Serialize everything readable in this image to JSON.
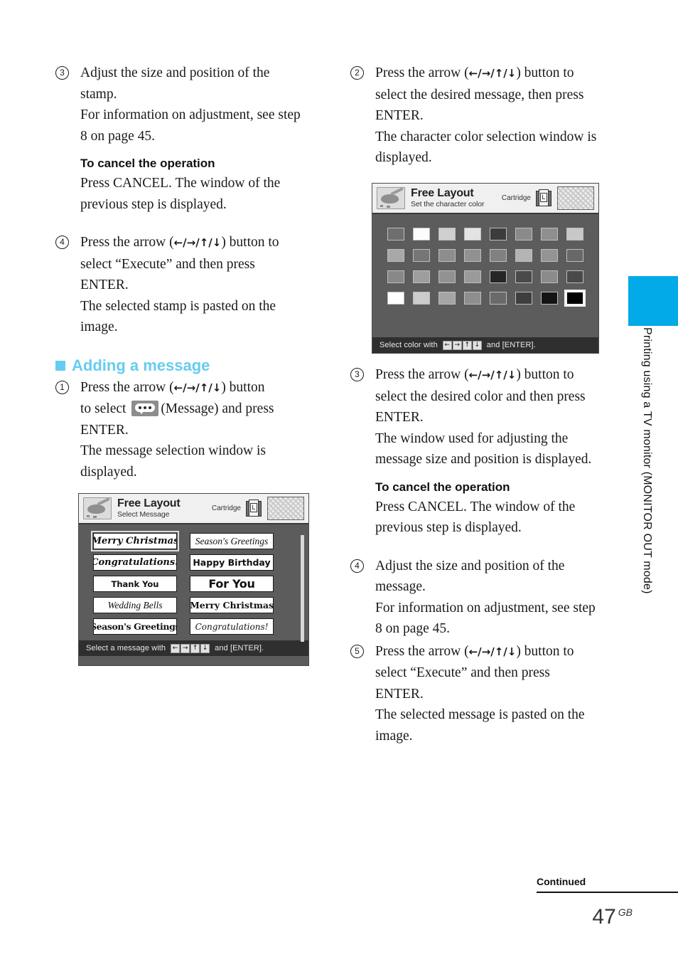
{
  "page": {
    "number": "47",
    "region_code": "GB",
    "continued_label": "Continued",
    "side_tab_text": "Printing using a TV monitor  (MONITOR OUT mode)",
    "accent_color": "#03AAE8",
    "heading_color": "#66CCF0"
  },
  "left_column": {
    "step3": {
      "num": "3",
      "line1": "Adjust the size and position of the stamp.",
      "line2": "For information on adjustment, see step 8 on page 45."
    },
    "cancel_heading": "To cancel the operation",
    "cancel_body": "Press CANCEL.  The window of the previous step is displayed.",
    "step4": {
      "num": "4",
      "line1_a": "Press the arrow (",
      "arrows": "←/→/↑/↓",
      "line1_b": ") button to select “Execute” and then press ENTER.",
      "line2": "The selected stamp is pasted on the image."
    },
    "section_heading": "Adding a message",
    "step1": {
      "num": "1",
      "line1_a": "Press the arrow (",
      "arrows": "←/→/↑/↓",
      "line1_b": ") button",
      "line2_a": "to select",
      "line2_b": "(Message) and press ENTER.",
      "line3": "The message selection window is displayed."
    }
  },
  "right_column": {
    "step2": {
      "num": "2",
      "line1_a": "Press the arrow  (",
      "arrows": "←/→/↑/↓",
      "line1_b": ") button to select the desired message, then press ENTER.",
      "line2": "The character color selection window is displayed."
    },
    "step3": {
      "num": "3",
      "line1_a": "Press the arrow (",
      "arrows": "←/→/↑/↓",
      "line1_b": ") button to select the desired color and then press ENTER.",
      "line2": "The window used for adjusting the message size and position is displayed."
    },
    "cancel_heading": "To cancel the operation",
    "cancel_body": "Press CANCEL.  The window of the previous step is displayed.",
    "step4": {
      "num": "4",
      "line1": "Adjust the size and position of the message.",
      "line2": "For information on adjustment, see step 8 on page 45."
    },
    "step5": {
      "num": "5",
      "line1_a": "Press the arrow (",
      "arrows": "←/→/↑/↓",
      "line1_b": ") button to select “Execute” and then press ENTER.",
      "line2": "The selected message is pasted on the image."
    }
  },
  "message_window": {
    "title": "Free Layout",
    "subtitle": "Select Message",
    "cartridge_label": "Cartridge",
    "cartridge_size": "L",
    "footer_prefix": "Select a message with",
    "footer_keys": [
      "←",
      "→",
      "↑",
      "↓"
    ],
    "footer_suffix": "and [ENTER].",
    "messages": [
      {
        "text": "Merry Christmas",
        "style": "f-script",
        "selected": true
      },
      {
        "text": "Season's Greetings",
        "style": "f-serif-i",
        "selected": false
      },
      {
        "text": "Congratulations!",
        "style": "f-script",
        "selected": false
      },
      {
        "text": "Happy Birthday",
        "style": "f-sans-b",
        "selected": false
      },
      {
        "text": "Thank You",
        "style": "f-sans-s",
        "selected": false
      },
      {
        "text": "For You",
        "style": "f-sans-bb",
        "selected": false
      },
      {
        "text": "Wedding Bells",
        "style": "f-serif-i",
        "selected": false
      },
      {
        "text": "Merry Christmas",
        "style": "f-old",
        "selected": false
      },
      {
        "text": "Season's Greetings",
        "style": "f-slab",
        "selected": false
      },
      {
        "text": "Congratulations!",
        "style": "f-script2",
        "selected": false
      }
    ]
  },
  "color_window": {
    "title": "Free Layout",
    "subtitle": "Set the character color",
    "cartridge_label": "Cartridge",
    "cartridge_size": "L",
    "footer_prefix": "Select color with",
    "footer_keys": [
      "←",
      "→",
      "↑",
      "↓"
    ],
    "footer_suffix": "and [ENTER].",
    "swatches": [
      {
        "color": "#6e6e6e",
        "selected": false
      },
      {
        "color": "#fcfcfc",
        "selected": false
      },
      {
        "color": "#cfcfcf",
        "selected": false
      },
      {
        "color": "#e3e3e3",
        "selected": false
      },
      {
        "color": "#3c3c3c",
        "selected": false
      },
      {
        "color": "#8a8a8a",
        "selected": false
      },
      {
        "color": "#8f8f8f",
        "selected": false
      },
      {
        "color": "#c8c8c8",
        "selected": false
      },
      {
        "color": "#a8a8a8",
        "selected": false
      },
      {
        "color": "#767676",
        "selected": false
      },
      {
        "color": "#8d8d8d",
        "selected": false
      },
      {
        "color": "#919191",
        "selected": false
      },
      {
        "color": "#818181",
        "selected": false
      },
      {
        "color": "#b4b4b4",
        "selected": false
      },
      {
        "color": "#949494",
        "selected": false
      },
      {
        "color": "#686868",
        "selected": false
      },
      {
        "color": "#888888",
        "selected": false
      },
      {
        "color": "#9e9e9e",
        "selected": false
      },
      {
        "color": "#929292",
        "selected": false
      },
      {
        "color": "#9a9a9a",
        "selected": false
      },
      {
        "color": "#262626",
        "selected": false
      },
      {
        "color": "#4a4a4a",
        "selected": false
      },
      {
        "color": "#8b8b8b",
        "selected": false
      },
      {
        "color": "#494949",
        "selected": false
      },
      {
        "color": "#ffffff",
        "selected": false
      },
      {
        "color": "#cccccc",
        "selected": false
      },
      {
        "color": "#a5a5a5",
        "selected": false
      },
      {
        "color": "#8e8e8e",
        "selected": false
      },
      {
        "color": "#6a6a6a",
        "selected": false
      },
      {
        "color": "#3e3e3e",
        "selected": false
      },
      {
        "color": "#141414",
        "selected": false
      },
      {
        "color": "#000000",
        "selected": true
      }
    ]
  }
}
